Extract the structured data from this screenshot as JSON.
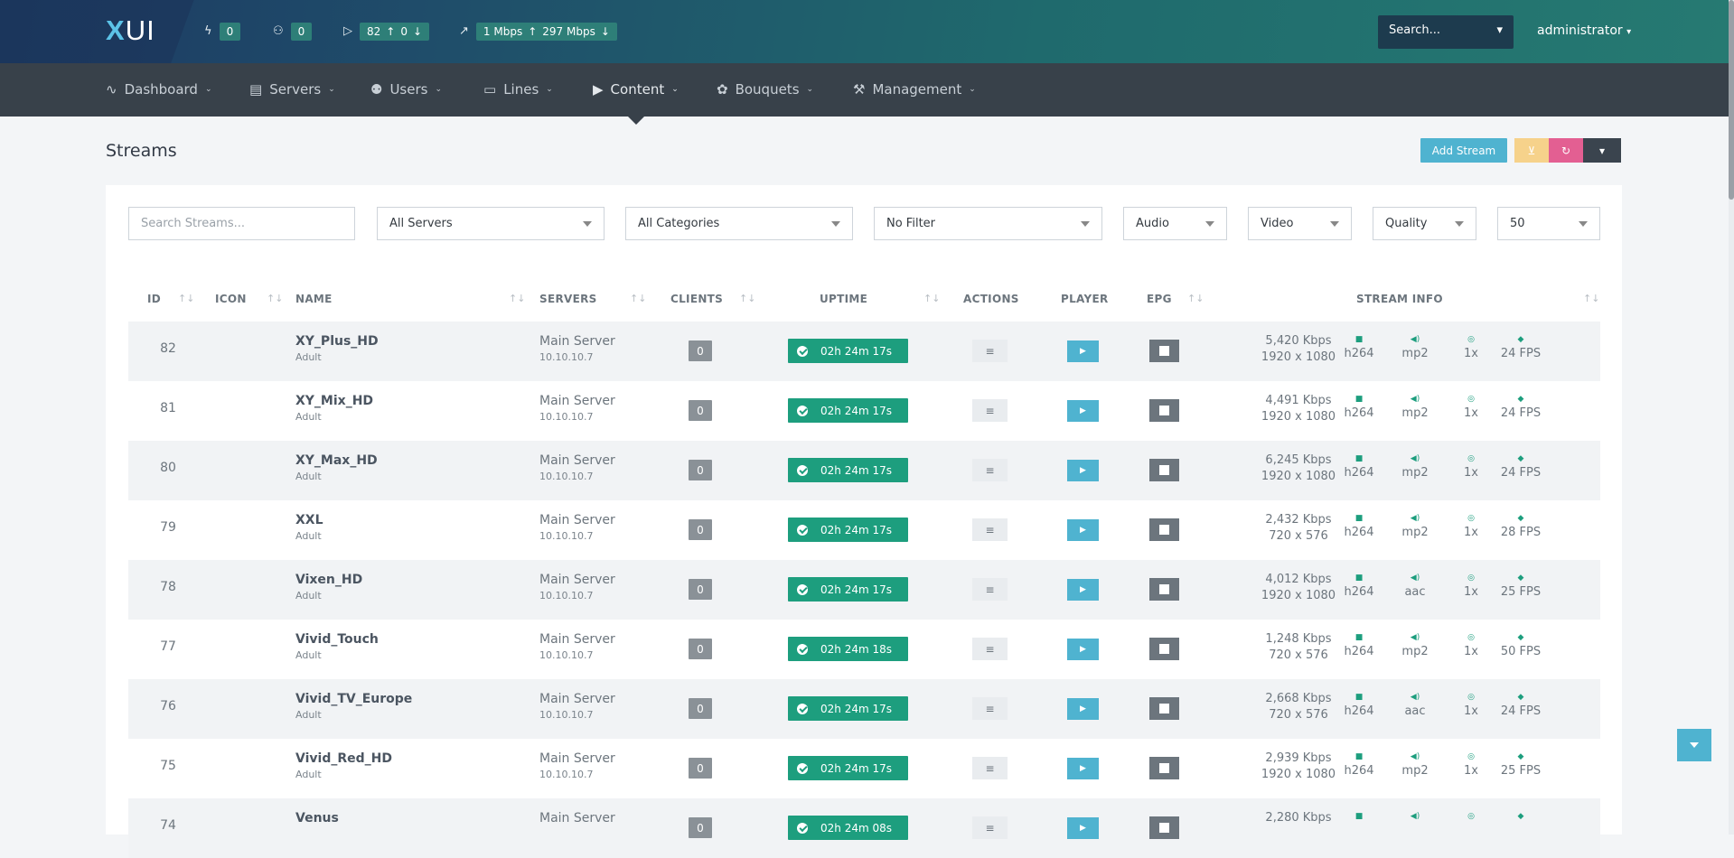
{
  "brand": {
    "logo_x": "X",
    "logo_rest": "UI"
  },
  "stats": {
    "connections": "0",
    "users": "0",
    "streams_up": "82",
    "streams_down": "0",
    "bandwidth_up": "1 Mbps",
    "bandwidth_down": "297 Mbps"
  },
  "search": {
    "placeholder": "Search..."
  },
  "user": {
    "name": "administrator"
  },
  "nav": [
    {
      "label": "Dashboard",
      "icon": "activity-icon"
    },
    {
      "label": "Servers",
      "icon": "server-icon"
    },
    {
      "label": "Users",
      "icon": "users-icon"
    },
    {
      "label": "Lines",
      "icon": "monitor-icon"
    },
    {
      "label": "Content",
      "icon": "play-icon"
    },
    {
      "label": "Bouquets",
      "icon": "flower-icon"
    },
    {
      "label": "Management",
      "icon": "wrench-icon"
    }
  ],
  "page": {
    "title": "Streams",
    "add_button": "Add Stream"
  },
  "filters": {
    "search_placeholder": "Search Streams...",
    "servers": "All Servers",
    "categories": "All Categories",
    "filter": "No Filter",
    "audio": "Audio",
    "video": "Video",
    "quality": "Quality",
    "per_page": "50"
  },
  "columns": {
    "id": "ID",
    "icon": "ICON",
    "name": "NAME",
    "servers": "SERVERS",
    "clients": "CLIENTS",
    "uptime": "UPTIME",
    "actions": "ACTIONS",
    "player": "PLAYER",
    "epg": "EPG",
    "stream_info": "STREAM INFO"
  },
  "rows": [
    {
      "id": "82",
      "name": "XY_Plus_HD",
      "category": "Adult",
      "server": "Main Server",
      "ip": "10.10.10.7",
      "clients": "0",
      "uptime": "02h 24m 17s",
      "bitrate": "5,420 Kbps",
      "resolution": "1920 x 1080",
      "vcodec": "h264",
      "acodec": "mp2",
      "speed": "1x",
      "fps": "24 FPS"
    },
    {
      "id": "81",
      "name": "XY_Mix_HD",
      "category": "Adult",
      "server": "Main Server",
      "ip": "10.10.10.7",
      "clients": "0",
      "uptime": "02h 24m 17s",
      "bitrate": "4,491 Kbps",
      "resolution": "1920 x 1080",
      "vcodec": "h264",
      "acodec": "mp2",
      "speed": "1x",
      "fps": "24 FPS"
    },
    {
      "id": "80",
      "name": "XY_Max_HD",
      "category": "Adult",
      "server": "Main Server",
      "ip": "10.10.10.7",
      "clients": "0",
      "uptime": "02h 24m 17s",
      "bitrate": "6,245 Kbps",
      "resolution": "1920 x 1080",
      "vcodec": "h264",
      "acodec": "mp2",
      "speed": "1x",
      "fps": "24 FPS"
    },
    {
      "id": "79",
      "name": "XXL",
      "category": "Adult",
      "server": "Main Server",
      "ip": "10.10.10.7",
      "clients": "0",
      "uptime": "02h 24m 17s",
      "bitrate": "2,432 Kbps",
      "resolution": "720 x 576",
      "vcodec": "h264",
      "acodec": "mp2",
      "speed": "1x",
      "fps": "28 FPS"
    },
    {
      "id": "78",
      "name": "Vixen_HD",
      "category": "Adult",
      "server": "Main Server",
      "ip": "10.10.10.7",
      "clients": "0",
      "uptime": "02h 24m 17s",
      "bitrate": "4,012 Kbps",
      "resolution": "1920 x 1080",
      "vcodec": "h264",
      "acodec": "aac",
      "speed": "1x",
      "fps": "25 FPS"
    },
    {
      "id": "77",
      "name": "Vivid_Touch",
      "category": "Adult",
      "server": "Main Server",
      "ip": "10.10.10.7",
      "clients": "0",
      "uptime": "02h 24m 18s",
      "bitrate": "1,248 Kbps",
      "resolution": "720 x 576",
      "vcodec": "h264",
      "acodec": "mp2",
      "speed": "1x",
      "fps": "50 FPS"
    },
    {
      "id": "76",
      "name": "Vivid_TV_Europe",
      "category": "Adult",
      "server": "Main Server",
      "ip": "10.10.10.7",
      "clients": "0",
      "uptime": "02h 24m 17s",
      "bitrate": "2,668 Kbps",
      "resolution": "720 x 576",
      "vcodec": "h264",
      "acodec": "aac",
      "speed": "1x",
      "fps": "24 FPS"
    },
    {
      "id": "75",
      "name": "Vivid_Red_HD",
      "category": "Adult",
      "server": "Main Server",
      "ip": "10.10.10.7",
      "clients": "0",
      "uptime": "02h 24m 17s",
      "bitrate": "2,939 Kbps",
      "resolution": "1920 x 1080",
      "vcodec": "h264",
      "acodec": "mp2",
      "speed": "1x",
      "fps": "25 FPS"
    },
    {
      "id": "74",
      "name": "Venus",
      "category": "",
      "server": "Main Server",
      "ip": "",
      "clients": "0",
      "uptime": "02h 24m 08s",
      "bitrate": "2,280 Kbps",
      "resolution": "",
      "vcodec": "",
      "acodec": "",
      "speed": "",
      "fps": ""
    }
  ]
}
